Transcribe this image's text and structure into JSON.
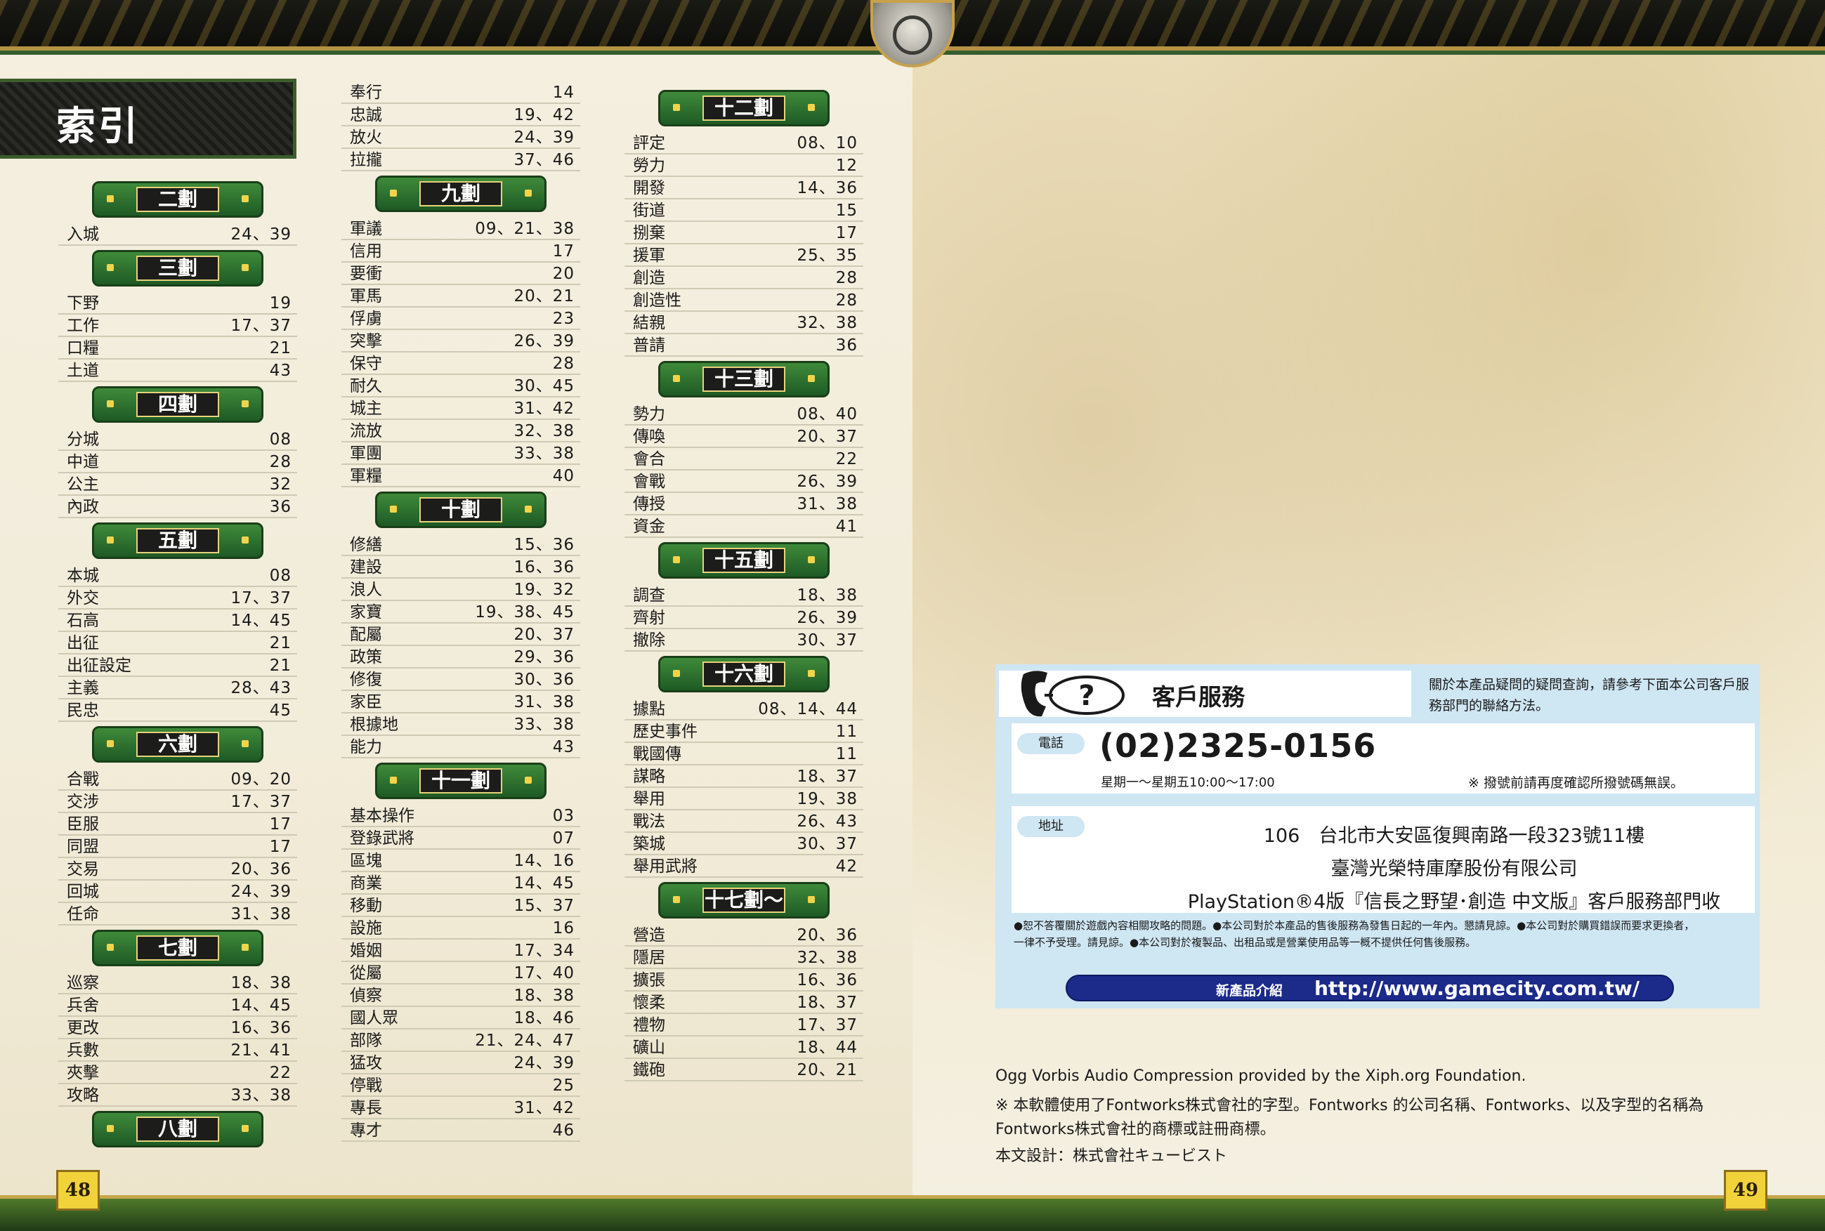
{
  "index": {
    "title": "索引",
    "columns": [
      [
        {
          "type": "section",
          "label": "二劃"
        },
        {
          "type": "entry",
          "name": "入城",
          "pages": "24、39"
        },
        {
          "type": "section",
          "label": "三劃"
        },
        {
          "type": "entry",
          "name": "下野",
          "pages": "19"
        },
        {
          "type": "entry",
          "name": "工作",
          "pages": "17、37"
        },
        {
          "type": "entry",
          "name": "口糧",
          "pages": "21"
        },
        {
          "type": "entry",
          "name": "土道",
          "pages": "43"
        },
        {
          "type": "section",
          "label": "四劃"
        },
        {
          "type": "entry",
          "name": "分城",
          "pages": "08"
        },
        {
          "type": "entry",
          "name": "中道",
          "pages": "28"
        },
        {
          "type": "entry",
          "name": "公主",
          "pages": "32"
        },
        {
          "type": "entry",
          "name": "內政",
          "pages": "36"
        },
        {
          "type": "section",
          "label": "五劃"
        },
        {
          "type": "entry",
          "name": "本城",
          "pages": "08"
        },
        {
          "type": "entry",
          "name": "外交",
          "pages": "17、37"
        },
        {
          "type": "entry",
          "name": "石高",
          "pages": "14、45"
        },
        {
          "type": "entry",
          "name": "出征",
          "pages": "21"
        },
        {
          "type": "entry",
          "name": "出征設定",
          "pages": "21"
        },
        {
          "type": "entry",
          "name": "主義",
          "pages": "28、43"
        },
        {
          "type": "entry",
          "name": "民忠",
          "pages": "45"
        },
        {
          "type": "section",
          "label": "六劃"
        },
        {
          "type": "entry",
          "name": "合戰",
          "pages": "09、20"
        },
        {
          "type": "entry",
          "name": "交涉",
          "pages": "17、37"
        },
        {
          "type": "entry",
          "name": "臣服",
          "pages": "17"
        },
        {
          "type": "entry",
          "name": "同盟",
          "pages": "17"
        },
        {
          "type": "entry",
          "name": "交易",
          "pages": "20、36"
        },
        {
          "type": "entry",
          "name": "回城",
          "pages": "24、39"
        },
        {
          "type": "entry",
          "name": "任命",
          "pages": "31、38"
        },
        {
          "type": "section",
          "label": "七劃"
        },
        {
          "type": "entry",
          "name": "巡察",
          "pages": "18、38"
        },
        {
          "type": "entry",
          "name": "兵舍",
          "pages": "14、45"
        },
        {
          "type": "entry",
          "name": "更改",
          "pages": "16、36"
        },
        {
          "type": "entry",
          "name": "兵數",
          "pages": "21、41"
        },
        {
          "type": "entry",
          "name": "夾擊",
          "pages": "22"
        },
        {
          "type": "entry",
          "name": "攻略",
          "pages": "33、38"
        },
        {
          "type": "section",
          "label": "八劃"
        }
      ],
      [
        {
          "type": "entry",
          "name": "奉行",
          "pages": "14"
        },
        {
          "type": "entry",
          "name": "忠誠",
          "pages": "19、42"
        },
        {
          "type": "entry",
          "name": "放火",
          "pages": "24、39"
        },
        {
          "type": "entry",
          "name": "拉攏",
          "pages": "37、46"
        },
        {
          "type": "section",
          "label": "九劃"
        },
        {
          "type": "entry",
          "name": "軍議",
          "pages": "09、21、38"
        },
        {
          "type": "entry",
          "name": "信用",
          "pages": "17"
        },
        {
          "type": "entry",
          "name": "要衝",
          "pages": "20"
        },
        {
          "type": "entry",
          "name": "軍馬",
          "pages": "20、21"
        },
        {
          "type": "entry",
          "name": "俘虜",
          "pages": "23"
        },
        {
          "type": "entry",
          "name": "突擊",
          "pages": "26、39"
        },
        {
          "type": "entry",
          "name": "保守",
          "pages": "28"
        },
        {
          "type": "entry",
          "name": "耐久",
          "pages": "30、45"
        },
        {
          "type": "entry",
          "name": "城主",
          "pages": "31、42"
        },
        {
          "type": "entry",
          "name": "流放",
          "pages": "32、38"
        },
        {
          "type": "entry",
          "name": "軍團",
          "pages": "33、38"
        },
        {
          "type": "entry",
          "name": "軍糧",
          "pages": "40"
        },
        {
          "type": "section",
          "label": "十劃"
        },
        {
          "type": "entry",
          "name": "修繕",
          "pages": "15、36"
        },
        {
          "type": "entry",
          "name": "建設",
          "pages": "16、36"
        },
        {
          "type": "entry",
          "name": "浪人",
          "pages": "19、32"
        },
        {
          "type": "entry",
          "name": "家寶",
          "pages": "19、38、45"
        },
        {
          "type": "entry",
          "name": "配屬",
          "pages": "20、37"
        },
        {
          "type": "entry",
          "name": "政策",
          "pages": "29、36"
        },
        {
          "type": "entry",
          "name": "修復",
          "pages": "30、36"
        },
        {
          "type": "entry",
          "name": "家臣",
          "pages": "31、38"
        },
        {
          "type": "entry",
          "name": "根據地",
          "pages": "33、38"
        },
        {
          "type": "entry",
          "name": "能力",
          "pages": "43"
        },
        {
          "type": "section",
          "label": "十一劃"
        },
        {
          "type": "entry",
          "name": "基本操作",
          "pages": "03"
        },
        {
          "type": "entry",
          "name": "登錄武將",
          "pages": "07"
        },
        {
          "type": "entry",
          "name": "區塊",
          "pages": "14、16"
        },
        {
          "type": "entry",
          "name": "商業",
          "pages": "14、45"
        },
        {
          "type": "entry",
          "name": "移動",
          "pages": "15、37"
        },
        {
          "type": "entry",
          "name": "設施",
          "pages": "16"
        },
        {
          "type": "entry",
          "name": "婚姻",
          "pages": "17、34"
        },
        {
          "type": "entry",
          "name": "從屬",
          "pages": "17、40"
        },
        {
          "type": "entry",
          "name": "偵察",
          "pages": "18、38"
        },
        {
          "type": "entry",
          "name": "國人眾",
          "pages": "18、46"
        },
        {
          "type": "entry",
          "name": "部隊",
          "pages": "21、24、47"
        },
        {
          "type": "entry",
          "name": "猛攻",
          "pages": "24、39"
        },
        {
          "type": "entry",
          "name": "停戰",
          "pages": "25"
        },
        {
          "type": "entry",
          "name": "專長",
          "pages": "31、42"
        },
        {
          "type": "entry",
          "name": "專才",
          "pages": "46"
        }
      ],
      [
        {
          "type": "section",
          "label": "十二劃"
        },
        {
          "type": "entry",
          "name": "評定",
          "pages": "08、10"
        },
        {
          "type": "entry",
          "name": "勞力",
          "pages": "12"
        },
        {
          "type": "entry",
          "name": "開發",
          "pages": "14、36"
        },
        {
          "type": "entry",
          "name": "街道",
          "pages": "15"
        },
        {
          "type": "entry",
          "name": "捌棄",
          "pages": "17"
        },
        {
          "type": "entry",
          "name": "援軍",
          "pages": "25、35"
        },
        {
          "type": "entry",
          "name": "創造",
          "pages": "28"
        },
        {
          "type": "entry",
          "name": "創造性",
          "pages": "28"
        },
        {
          "type": "entry",
          "name": "結親",
          "pages": "32、38"
        },
        {
          "type": "entry",
          "name": "普請",
          "pages": "36"
        },
        {
          "type": "section",
          "label": "十三劃"
        },
        {
          "type": "entry",
          "name": "勢力",
          "pages": "08、40"
        },
        {
          "type": "entry",
          "name": "傳喚",
          "pages": "20、37"
        },
        {
          "type": "entry",
          "name": "會合",
          "pages": "22"
        },
        {
          "type": "entry",
          "name": "會戰",
          "pages": "26、39"
        },
        {
          "type": "entry",
          "name": "傳授",
          "pages": "31、38"
        },
        {
          "type": "entry",
          "name": "資金",
          "pages": "41"
        },
        {
          "type": "section",
          "label": "十五劃"
        },
        {
          "type": "entry",
          "name": "調查",
          "pages": "18、38"
        },
        {
          "type": "entry",
          "name": "齊射",
          "pages": "26、39"
        },
        {
          "type": "entry",
          "name": "撤除",
          "pages": "30、37"
        },
        {
          "type": "section",
          "label": "十六劃"
        },
        {
          "type": "entry",
          "name": "據點",
          "pages": "08、14、44"
        },
        {
          "type": "entry",
          "name": "歷史事件",
          "pages": "11"
        },
        {
          "type": "entry",
          "name": "戰國傳",
          "pages": "11"
        },
        {
          "type": "entry",
          "name": "謀略",
          "pages": "18、37"
        },
        {
          "type": "entry",
          "name": "舉用",
          "pages": "19、38"
        },
        {
          "type": "entry",
          "name": "戰法",
          "pages": "26、43"
        },
        {
          "type": "entry",
          "name": "築城",
          "pages": "30、37"
        },
        {
          "type": "entry",
          "name": "舉用武將",
          "pages": "42"
        },
        {
          "type": "section",
          "label": "十七劃～"
        },
        {
          "type": "entry",
          "name": "營造",
          "pages": "20、36"
        },
        {
          "type": "entry",
          "name": "隱居",
          "pages": "32、38"
        },
        {
          "type": "entry",
          "name": "擴張",
          "pages": "16、36"
        },
        {
          "type": "entry",
          "name": "懷柔",
          "pages": "18、37"
        },
        {
          "type": "entry",
          "name": "禮物",
          "pages": "17、37"
        },
        {
          "type": "entry",
          "name": "礦山",
          "pages": "18、44"
        },
        {
          "type": "entry",
          "name": "鐵砲",
          "pages": "20、21"
        }
      ]
    ]
  },
  "page_numbers": {
    "left": "48",
    "right": "49"
  },
  "customer_service": {
    "title": "客戶服務",
    "description": "關於本產品疑問的疑問查詢，請參考下面本公司客戶服務部門的聯絡方法。",
    "phone_tag": "電話",
    "phone": "(02)2325-0156",
    "hours": "星期一～星期五10:00～17:00",
    "dial_note": "※ 撥號前請再度確認所撥號碼無誤。",
    "address_tag": "地址",
    "address_line1": "106　台北市大安區復興南路一段323號11樓",
    "address_line2": "臺灣光榮特庫摩股份有限公司",
    "address_line3": "PlayStation®4版『信長之野望･創造 中文版』客戶服務部門收",
    "notes_line1": "●恕不答覆關於遊戲內容相關攻略的問題。●本公司對於本產品的售後服務為發售日起的一年內。懇請見諒。●本公司對於購買錯誤而要求更換者，",
    "notes_line2": "一律不予受理。請見諒。●本公司對於複製品、出租品或是營業使用品等一概不提供任何售後服務。",
    "new_products_label": "新產品介紹",
    "url": "http://www.gamecity.com.tw/"
  },
  "footer": {
    "line1": "Ogg Vorbis Audio Compression provided by the Xiph.org Foundation.",
    "line2": "※  本軟體使用了Fontworks株式會社的字型。Fontworks 的公司名稱、Fontworks、以及字型的名稱為",
    "line3": "Fontworks株式會社的商標或註冊商標。",
    "line4": "本文設計：株式會社キュービスト"
  },
  "colors": {
    "section_green": "#2e7a33",
    "section_label_bg": "#1c1c1a",
    "service_blue": "#cfe6f3",
    "url_bar": "#1c2a8a",
    "page_number_yellow": "#f1d23a"
  },
  "icons": [
    "family-crest-icon",
    "telephone-icon",
    "question-bubble-icon"
  ]
}
